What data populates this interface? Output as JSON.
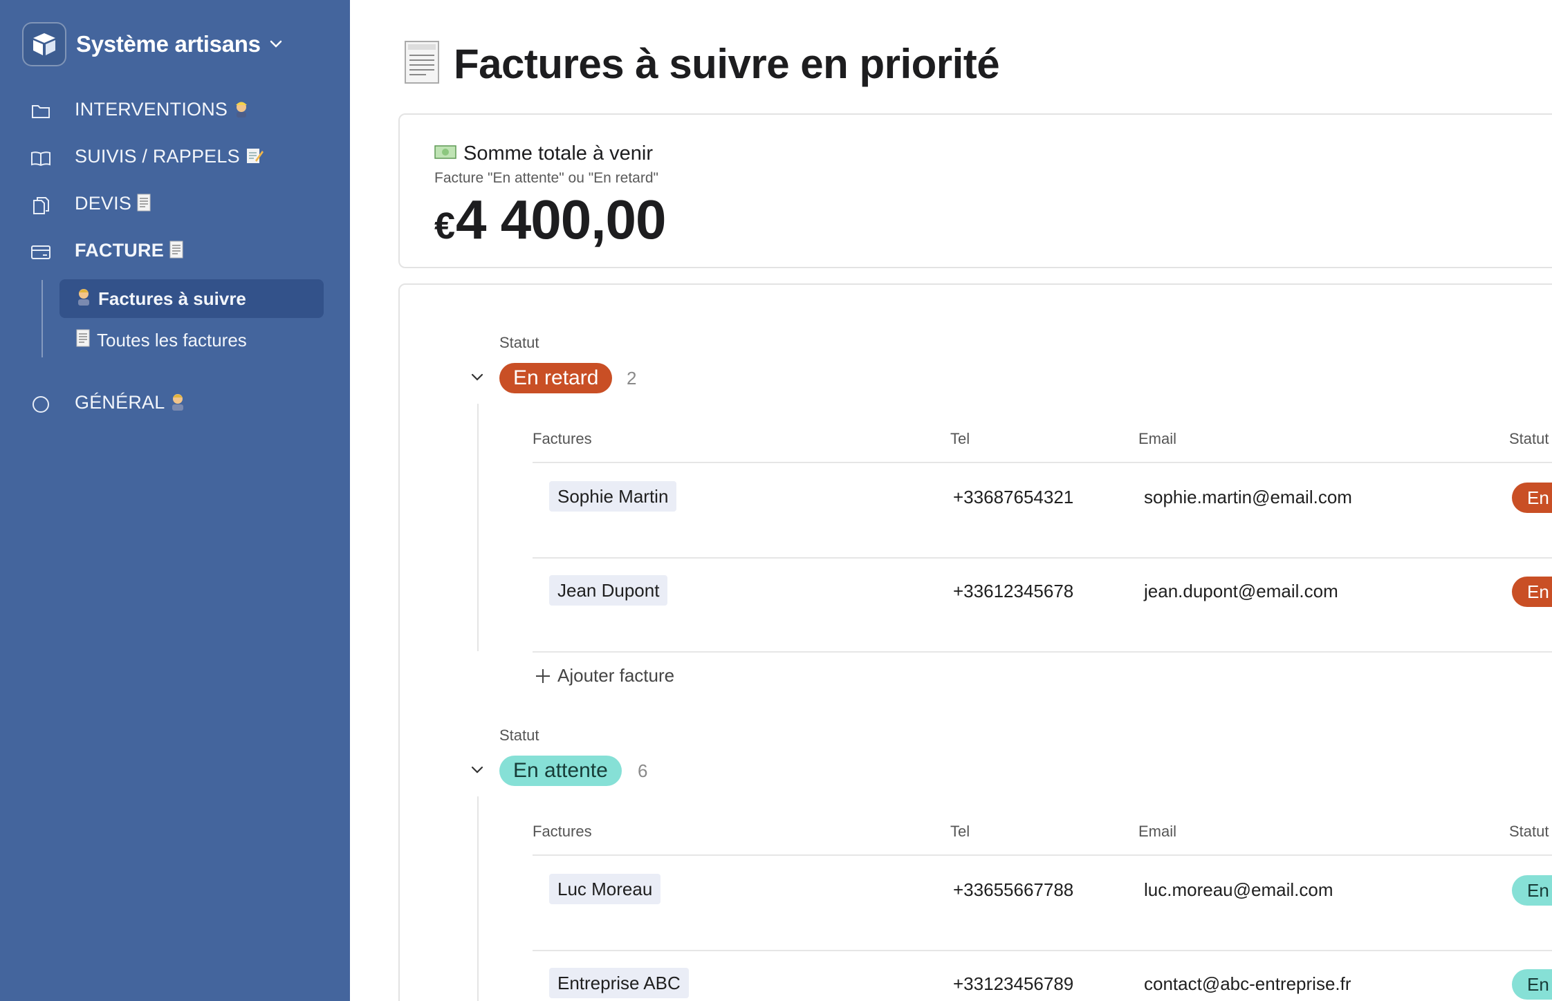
{
  "workspace": {
    "name": "Système artisans",
    "icon": "cube-logo-icon"
  },
  "sidebar": {
    "items": [
      {
        "label": "INTERVENTIONS",
        "emoji": "worker-emoji",
        "icon": "folder-icon"
      },
      {
        "label": "SUIVIS / RAPPELS",
        "emoji": "memo-emoji",
        "icon": "book-icon"
      },
      {
        "label": "DEVIS",
        "emoji": "receipt-emoji",
        "icon": "documents-icon"
      },
      {
        "label": "FACTURE",
        "emoji": "receipt-emoji",
        "icon": "card-icon"
      },
      {
        "label": "GÉNÉRAL",
        "emoji": "person-emoji",
        "icon": "circle-icon"
      }
    ],
    "subitems": [
      {
        "label": "Factures à suivre",
        "emoji": "person-emoji",
        "active": true
      },
      {
        "label": "Toutes les factures",
        "emoji": "receipt-emoji",
        "active": false
      }
    ]
  },
  "page": {
    "title": "Factures à suivre en priorité",
    "emoji": "receipt-emoji"
  },
  "summary": {
    "title": "Somme totale à venir",
    "emoji": "money-emoji",
    "subtitle": "Facture \"En attente\" ou \"En retard\"",
    "currency": "€",
    "value": "4 400,00"
  },
  "table": {
    "columns": [
      "Factures",
      "Tel",
      "Email",
      "Statut"
    ],
    "add_label": "Ajouter facture"
  },
  "groups": [
    {
      "field_label": "Statut",
      "status": "En retard",
      "count": "2",
      "color": "#c94f25",
      "rows": [
        {
          "name": "Sophie Martin",
          "tel": "+33687654321",
          "email": "sophie.martin@email.com",
          "status": "En"
        },
        {
          "name": "Jean Dupont",
          "tel": "+33612345678",
          "email": "jean.dupont@email.com",
          "status": "En"
        }
      ]
    },
    {
      "field_label": "Statut",
      "status": "En attente",
      "count": "6",
      "color": "#86e0d6",
      "rows": [
        {
          "name": "Luc Moreau",
          "tel": "+33655667788",
          "email": "luc.moreau@email.com",
          "status": "En"
        },
        {
          "name": "Entreprise ABC",
          "tel": "+33123456789",
          "email": "contact@abc-entreprise.fr",
          "status": "En"
        }
      ]
    }
  ]
}
